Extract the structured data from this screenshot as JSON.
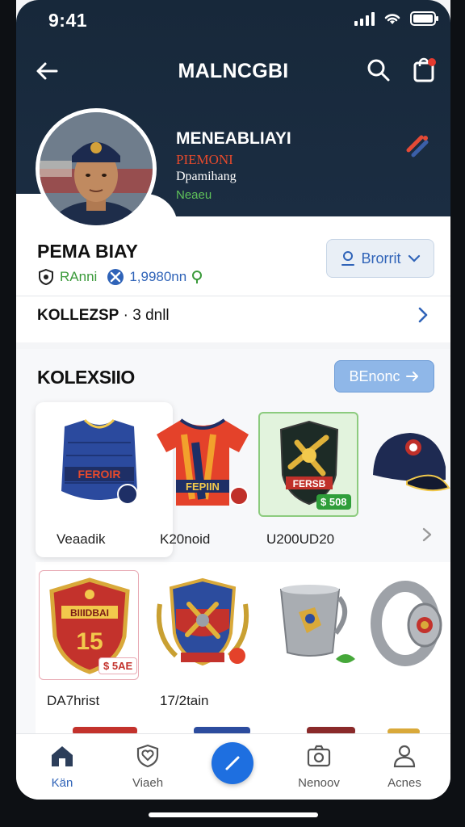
{
  "status_bar": {
    "time": "9:41"
  },
  "header": {
    "title": "MALNCGBI"
  },
  "hero": {
    "name": "MENEABLIAYI",
    "line2": "PIEMONI",
    "line3": "Dpamihang",
    "line4": "Neaeu"
  },
  "profile": {
    "name": "PEMA BIAY",
    "rank": "RAnni",
    "score": "1,9980nn",
    "follow_label": "Brorrit",
    "collection_label": "KOLLEZSP",
    "collection_count": "· 3 dnll"
  },
  "section": {
    "title": "KOLEXSIIO",
    "button_label": "BEnonc"
  },
  "items": [
    {
      "label": "Veaadik",
      "icon": "blue-jersey"
    },
    {
      "label": "K20noid",
      "icon": "red-jersey"
    },
    {
      "label": "U200UD20",
      "icon": "shield-badge",
      "price": "$ 508"
    },
    {
      "label": "",
      "icon": "navy-cap"
    },
    {
      "label": "DA7hrist",
      "icon": "red-crest-15",
      "crest_number": "15",
      "price": "$ 5AE"
    },
    {
      "label": "17/2tain",
      "icon": "emblem-crest"
    },
    {
      "label": "",
      "icon": "silver-cup"
    },
    {
      "label": "",
      "icon": "ring"
    }
  ],
  "bottom_nav": {
    "tabs": [
      {
        "label": "Kän",
        "icon": "home-icon"
      },
      {
        "label": "Viaeh",
        "icon": "shield-heart-icon"
      },
      {
        "label": "Nenoov",
        "icon": "camera-icon"
      },
      {
        "label": "Acnes",
        "icon": "person-icon"
      }
    ]
  },
  "colors": {
    "header_bg": "#17283a",
    "accent_blue": "#2f63b8",
    "fab": "#1e6fe0",
    "green": "#3a9a3a",
    "red": "#e74a2c"
  }
}
